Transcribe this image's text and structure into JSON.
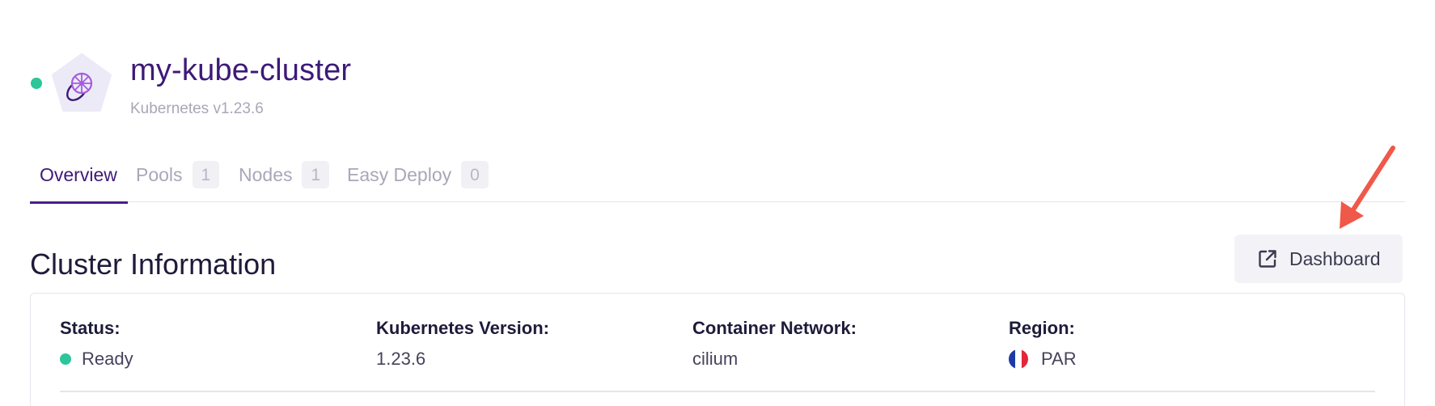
{
  "header": {
    "cluster_name": "my-kube-cluster",
    "subtitle": "Kubernetes v1.23.6",
    "status_color": "#2dc59a",
    "logo_icon": "kubernetes-helm-icon"
  },
  "tabs": [
    {
      "label": "Overview",
      "count": null,
      "active": true
    },
    {
      "label": "Pools",
      "count": "1",
      "active": false
    },
    {
      "label": "Nodes",
      "count": "1",
      "active": false
    },
    {
      "label": "Easy Deploy",
      "count": "0",
      "active": false
    }
  ],
  "section": {
    "title": "Cluster Information",
    "dashboard_button": {
      "label": "Dashboard",
      "icon": "external-link-icon"
    }
  },
  "info": {
    "status": {
      "label": "Status:",
      "value": "Ready"
    },
    "version": {
      "label": "Kubernetes Version:",
      "value": "1.23.6"
    },
    "network": {
      "label": "Container Network:",
      "value": "cilium"
    },
    "region": {
      "label": "Region:",
      "value": "PAR",
      "flag_icon": "france-flag-icon"
    }
  },
  "colors": {
    "brand": "#3d1a78",
    "accent": "#4a1d8c",
    "success": "#2dc59a",
    "annotation_arrow": "#f0584a"
  }
}
